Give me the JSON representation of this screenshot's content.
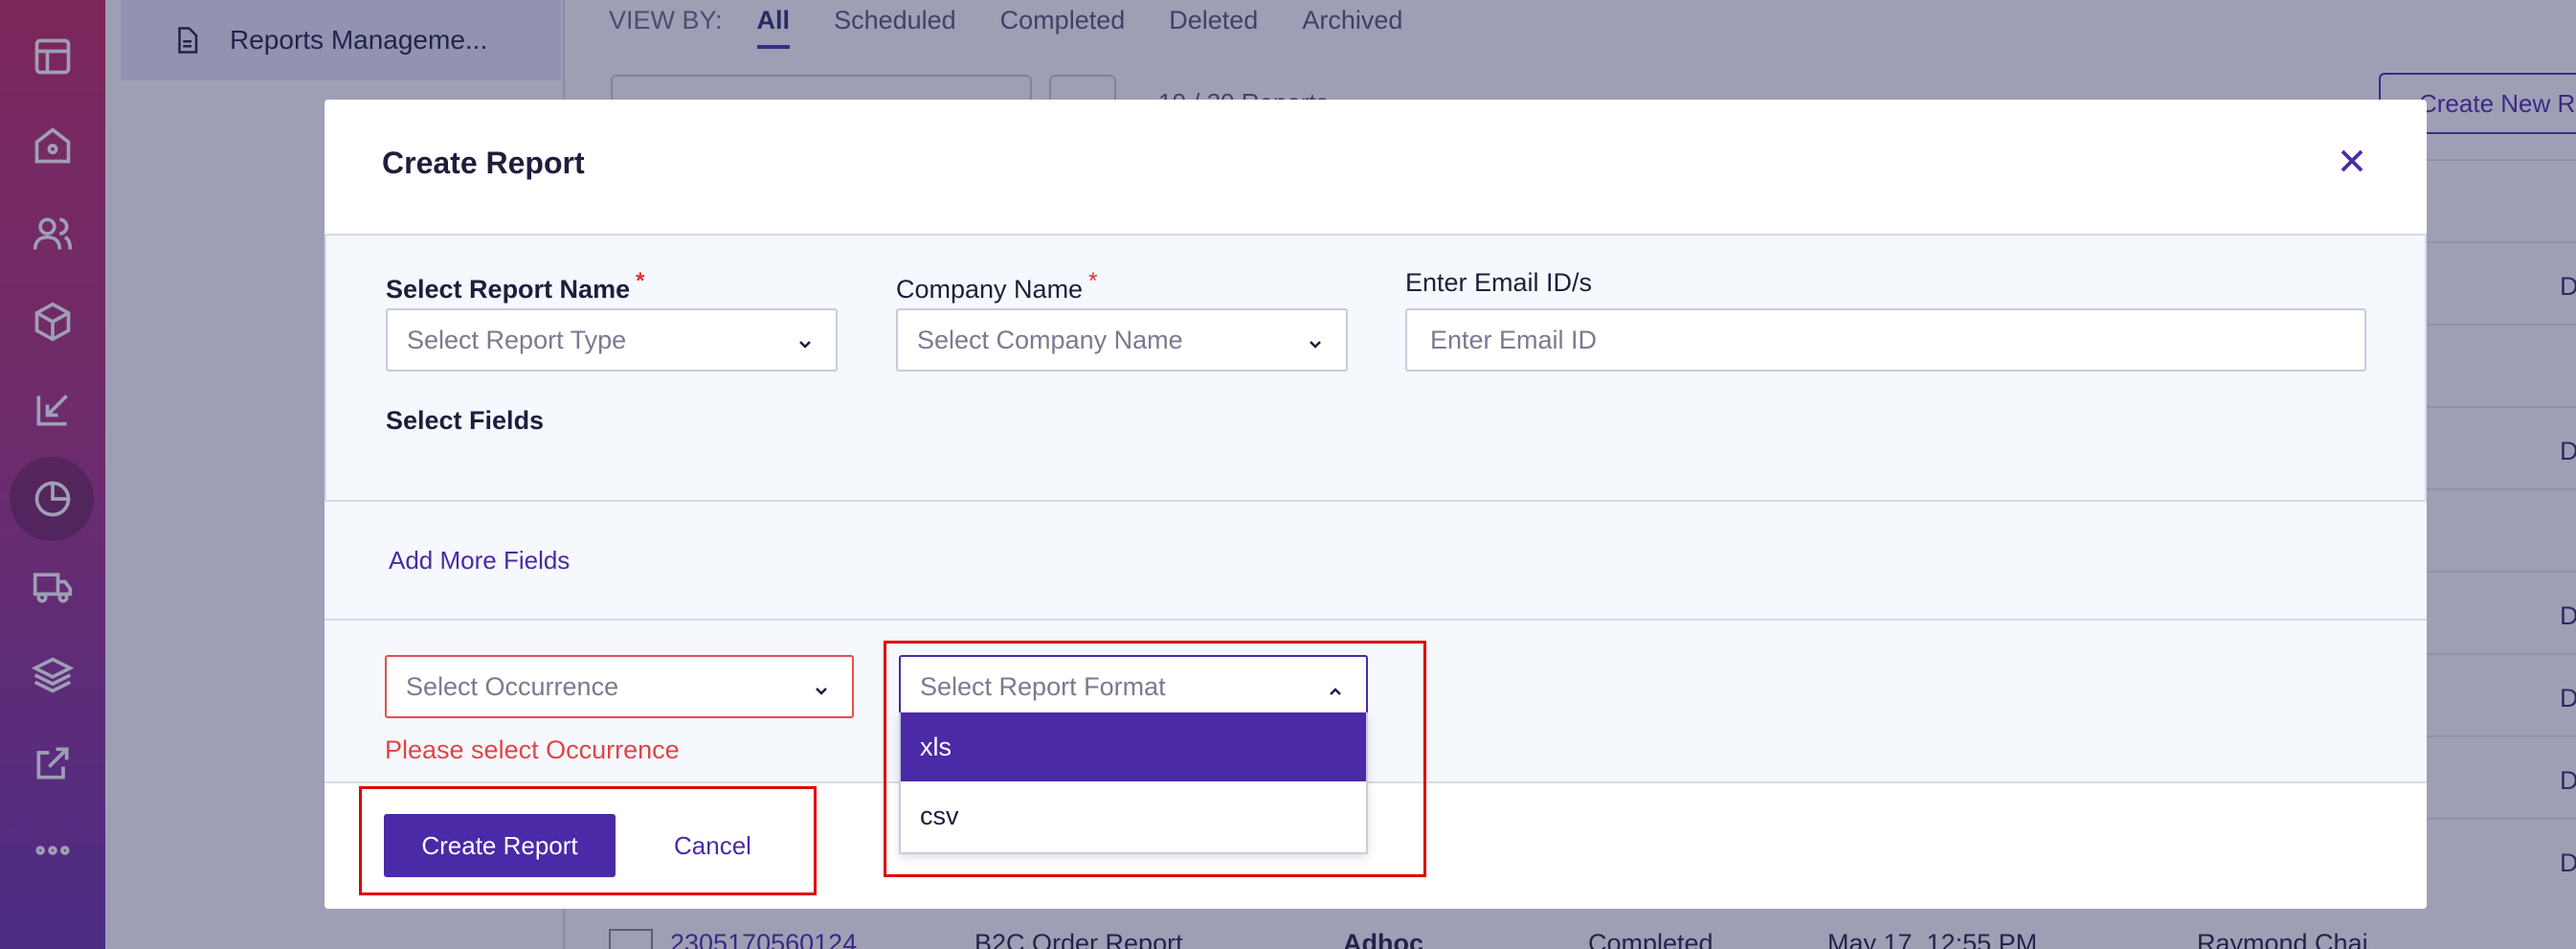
{
  "sidebar": {
    "item_label": "Reports Manageme..."
  },
  "rail_icons": [
    "layout-icon",
    "home-icon",
    "users-icon",
    "box-icon",
    "import-icon",
    "pie-chart-icon",
    "truck-icon",
    "layers-icon",
    "external-link-icon",
    "more-icon"
  ],
  "main": {
    "viewby_label": "VIEW BY:",
    "tabs": [
      "All",
      "Scheduled",
      "Completed",
      "Deleted",
      "Archived"
    ],
    "count_text": "10 / 20 Reports",
    "create_new_label": "Create New Re",
    "row_letter": "D",
    "bottom_row": {
      "id": "2305170560124",
      "name": "B2C Order Report",
      "type": "Adhoc",
      "status": "Completed",
      "date": "May 17, 12:55 PM",
      "user": "Raymond Chai"
    }
  },
  "modal": {
    "title": "Create Report",
    "report_name": {
      "label": "Select Report Name",
      "required_mark": "*",
      "placeholder": "Select Report Type"
    },
    "company_name": {
      "label": "Company Name",
      "required_mark": "*",
      "placeholder": "Select Company Name"
    },
    "email": {
      "label": "Enter Email ID/s",
      "placeholder": "Enter Email ID"
    },
    "select_fields_label": "Select Fields",
    "add_more_fields_label": "Add More Fields",
    "occurrence": {
      "placeholder": "Select Occurrence",
      "error": "Please select Occurrence"
    },
    "report_format": {
      "placeholder": "Select Report Format",
      "options": [
        "xls",
        "csv"
      ],
      "highlighted": "xls"
    },
    "create_button_label": "Create Report",
    "cancel_label": "Cancel"
  },
  "colors": {
    "accent": "#4a2aa6",
    "error": "#e04545",
    "highlight_box": "#e00000"
  }
}
